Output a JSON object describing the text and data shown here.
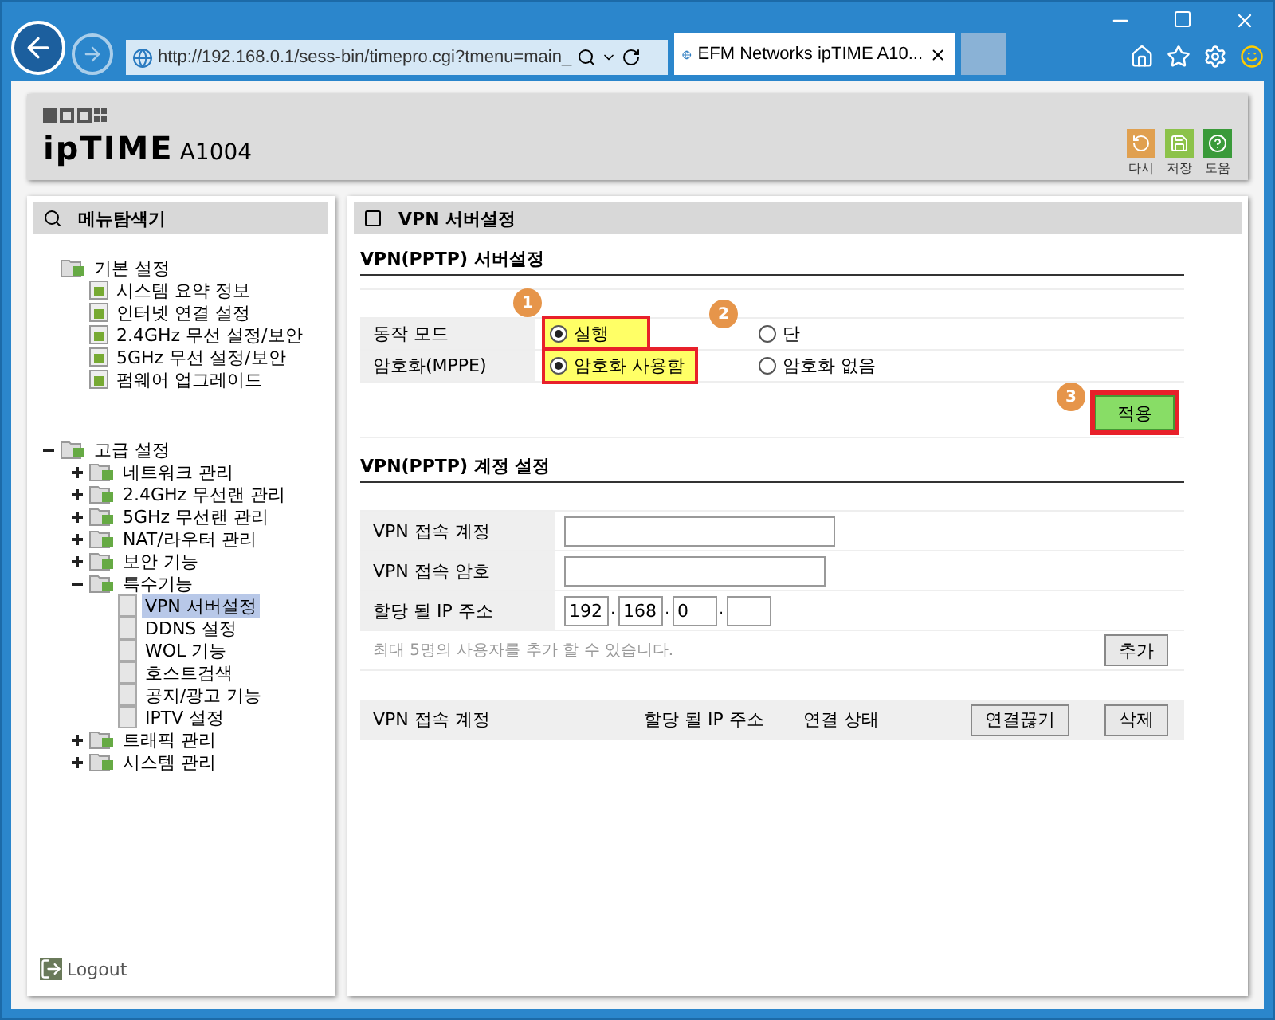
{
  "browser": {
    "address": "http://192.168.0.1/sess-bin/timepro.cgi?tmenu=main_",
    "tab_title": "EFM Networks ipTIME A10..."
  },
  "header": {
    "logo": "ipTIME",
    "model": "A1004",
    "actions": [
      {
        "label": "다시",
        "kind": "reload"
      },
      {
        "label": "저장",
        "kind": "save"
      },
      {
        "label": "도움",
        "kind": "help"
      }
    ]
  },
  "sidebar": {
    "title": "메뉴탐색기",
    "logout": "Logout",
    "tree": [
      {
        "label": "기본 설정",
        "kind": "folder",
        "children": [
          {
            "label": "시스템 요약 정보",
            "kind": "page"
          },
          {
            "label": "인터넷 연결 설정",
            "kind": "page"
          },
          {
            "label": "2.4GHz 무선 설정/보안",
            "kind": "page"
          },
          {
            "label": "5GHz 무선 설정/보안",
            "kind": "page"
          },
          {
            "label": "펌웨어 업그레이드",
            "kind": "page"
          }
        ]
      },
      {
        "label": "고급 설정",
        "kind": "folder",
        "expanded": true,
        "children": [
          {
            "label": "네트워크 관리",
            "kind": "folder",
            "expanded": false
          },
          {
            "label": "2.4GHz 무선랜 관리",
            "kind": "folder",
            "expanded": false
          },
          {
            "label": "5GHz 무선랜 관리",
            "kind": "folder",
            "expanded": false
          },
          {
            "label": "NAT/라우터 관리",
            "kind": "folder",
            "expanded": false
          },
          {
            "label": "보안 기능",
            "kind": "folder",
            "expanded": false
          },
          {
            "label": "특수기능",
            "kind": "folder",
            "expanded": true,
            "children": [
              {
                "label": "VPN 서버설정",
                "kind": "blank",
                "selected": true
              },
              {
                "label": "DDNS 설정",
                "kind": "blank",
                "selected": false
              },
              {
                "label": "WOL 기능",
                "kind": "blank",
                "selected": false
              },
              {
                "label": "호스트검색",
                "kind": "blank",
                "selected": false
              },
              {
                "label": "공지/광고 기능",
                "kind": "blank",
                "selected": false
              },
              {
                "label": "IPTV 설정",
                "kind": "blank",
                "selected": false
              }
            ]
          },
          {
            "label": "트래픽 관리",
            "kind": "folder",
            "expanded": false
          },
          {
            "label": "시스템 관리",
            "kind": "folder",
            "expanded": false
          }
        ]
      }
    ]
  },
  "content": {
    "title": "VPN 서버설정",
    "server": {
      "title": "VPN(PPTP) 서버설정",
      "rows": [
        {
          "label": "동작 모드",
          "options": [
            {
              "label": "실행",
              "selected": true,
              "highlighted": true,
              "badge": "1"
            },
            {
              "label": "단",
              "selected": false,
              "highlighted": false,
              "badge": "2"
            }
          ]
        },
        {
          "label": "암호화(MPPE)",
          "options": [
            {
              "label": "암호화 사용함",
              "selected": true,
              "highlighted": true
            },
            {
              "label": "암호화 없음",
              "selected": false,
              "highlighted": false
            }
          ]
        }
      ],
      "apply": {
        "label": "적용",
        "badge": "3",
        "highlighted": true
      }
    },
    "account": {
      "title": "VPN(PPTP) 계정 설정",
      "fields": [
        {
          "label": "VPN 접속 계정",
          "kind": "text"
        },
        {
          "label": "VPN 접속 암호",
          "kind": "text"
        },
        {
          "label": "할당 될 IP 주소",
          "kind": "ip",
          "parts": [
            "192",
            "168",
            "0"
          ],
          "separator": "."
        }
      ],
      "note": "최대 5명의 사용자를 추가 할 수 있습니다.",
      "add": "추가"
    },
    "table": {
      "columns": [
        "VPN 접속 계정",
        "할당 될 IP 주소",
        "연결 상태"
      ],
      "buttons": [
        "연결끊기",
        "삭제"
      ]
    }
  }
}
